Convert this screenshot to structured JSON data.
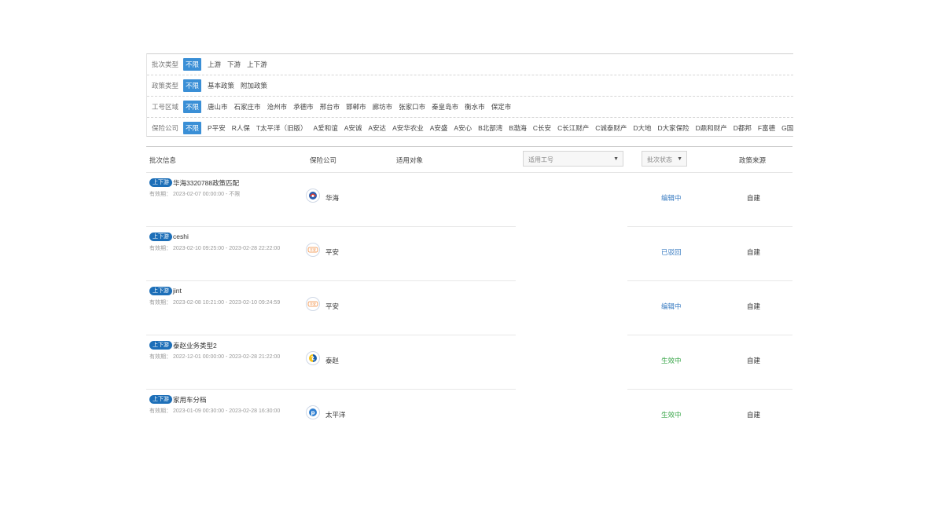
{
  "filters": [
    {
      "label": "批次类型",
      "options": [
        "不限",
        "上游",
        "下游",
        "上下游"
      ]
    },
    {
      "label": "政策类型",
      "options": [
        "不限",
        "基本政策",
        "附加政策"
      ]
    },
    {
      "label": "工号区域",
      "options": [
        "不限",
        "唐山市",
        "石家庄市",
        "沧州市",
        "承德市",
        "邢台市",
        "邯郸市",
        "廊坊市",
        "张家口市",
        "秦皇岛市",
        "衡水市",
        "保定市"
      ]
    },
    {
      "label": "保险公司",
      "options": [
        "不限",
        "P平安",
        "R人保",
        "T太平洋（旧版）",
        "A爱和谊",
        "A安诚",
        "A安达",
        "A安华农业",
        "A安盛",
        "A安心",
        "B北部湾",
        "B渤海",
        "C长安",
        "C长江财产",
        "C诚泰财产",
        "D大地",
        "D大家保险",
        "D鼎和财产",
        "D都邦",
        "F富德",
        "G国任"
      ]
    }
  ],
  "table": {
    "headers": {
      "batch_info": "批次信息",
      "insurer": "保险公司",
      "target": "适用对象",
      "job_select": "适用工号",
      "status_select": "批次状态",
      "source": "政策来源"
    },
    "rows": [
      {
        "badge": "上下游",
        "name": "华海3320788政策匹配",
        "validity_label": "有效期：",
        "validity": "2023-02-07 00:00:00 - 不限",
        "insurer": "华海",
        "insurer_icon": "huahai-logo-icon",
        "status": "编辑中",
        "status_color": "#3a7cc2",
        "source": "自建"
      },
      {
        "badge": "上下游",
        "name": "ceshi",
        "validity_label": "有效期：",
        "validity": "2023-02-10 09:25:00 - 2023-02-28 22:22:00",
        "insurer": "平安",
        "insurer_icon": "pingan-logo-icon",
        "status": "已驳回",
        "status_color": "#3a7cc2",
        "source": "自建"
      },
      {
        "badge": "上下游",
        "name": "jint",
        "validity_label": "有效期：",
        "validity": "2023-02-08 10:21:00 - 2023-02-10 09:24:59",
        "insurer": "平安",
        "insurer_icon": "pingan-logo-icon",
        "status": "编辑中",
        "status_color": "#3a7cc2",
        "source": "自建"
      },
      {
        "badge": "上下游",
        "name": "泰赵业务类型2",
        "validity_label": "有效期：",
        "validity": "2022-12-01 00:00:00 - 2023-02-28 21:22:00",
        "insurer": "泰赵",
        "insurer_icon": "taizhao-logo-icon",
        "status": "生效中",
        "status_color": "#3aa64a",
        "source": "自建"
      },
      {
        "badge": "上下游",
        "name": "家用车分档",
        "validity_label": "有效期：",
        "validity": "2023-01-09 00:30:00 - 2023-02-28 16:30:00",
        "insurer": "太平洋",
        "insurer_icon": "taipingyang-logo-icon",
        "status": "生效中",
        "status_color": "#3aa64a",
        "source": "自建"
      }
    ]
  }
}
